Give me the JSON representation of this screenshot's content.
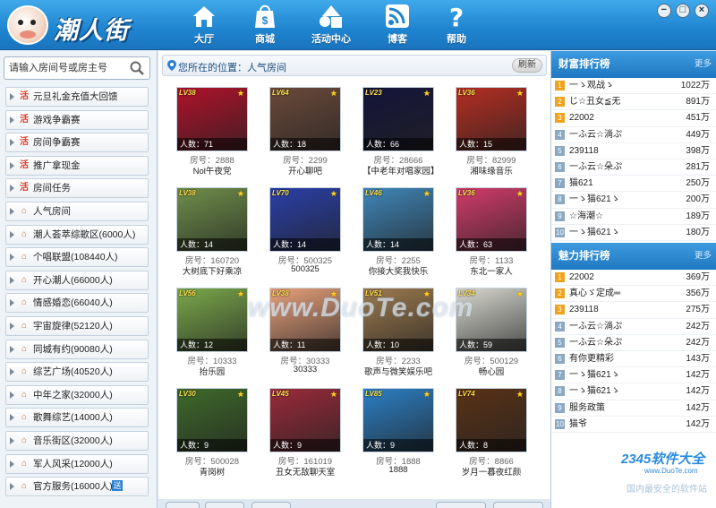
{
  "app": {
    "logo_text": "潮人街"
  },
  "nav": [
    {
      "label": "大厅",
      "icon": "home-icon"
    },
    {
      "label": "商城",
      "icon": "shopping-bag-icon"
    },
    {
      "label": "活动中心",
      "icon": "shapes-icon"
    },
    {
      "label": "博客",
      "icon": "rss-icon"
    },
    {
      "label": "帮助",
      "icon": "question-icon"
    }
  ],
  "window_buttons": [
    "−",
    "□",
    "×"
  ],
  "search": {
    "placeholder": "请输入房间号或房主号"
  },
  "menu": [
    {
      "label": "元旦礼金充值大回馈",
      "icon": "hot"
    },
    {
      "label": "游戏争霸赛",
      "icon": "hot"
    },
    {
      "label": "房间争霸赛",
      "icon": "hot"
    },
    {
      "label": "推广拿现金",
      "icon": "hot"
    },
    {
      "label": "房间任务",
      "icon": "hot"
    },
    {
      "label": "人气房间",
      "icon": "house"
    },
    {
      "label": "潮人荟萃综歌区(6000人)",
      "icon": "house"
    },
    {
      "label": "个唱联盟(108440人)",
      "icon": "house"
    },
    {
      "label": "开心潮人(66000人)",
      "icon": "house"
    },
    {
      "label": "情感婚恋(66040人)",
      "icon": "house"
    },
    {
      "label": "宇宙旋律(52120人)",
      "icon": "house"
    },
    {
      "label": "同城有约(90080人)",
      "icon": "house"
    },
    {
      "label": "综艺广场(40520人)",
      "icon": "house"
    },
    {
      "label": "中年之家(32000人)",
      "icon": "house"
    },
    {
      "label": "歌舞综艺(14000人)",
      "icon": "house"
    },
    {
      "label": "音乐街区(32000人)",
      "icon": "house"
    },
    {
      "label": "军人风采(12000人)",
      "icon": "house"
    },
    {
      "label": "官方服务(16000人)",
      "icon": "house",
      "badge": "送"
    }
  ],
  "location": {
    "text": "您所在的位置：人气房间",
    "refresh_label": "刷新"
  },
  "rooms": [
    {
      "level": "LV38",
      "count": "人数：71",
      "room_no": "房号：2888",
      "name": "Nol午夜党",
      "theme": "#b0122a"
    },
    {
      "level": "LV64",
      "count": "人数：18",
      "room_no": "房号：2299",
      "name": "开心聊吧",
      "theme": "#6b4a3a"
    },
    {
      "level": "LV23",
      "count": "人数：66",
      "room_no": "房号：28666",
      "name": "【中老年对唱家园】",
      "theme": "#14143a"
    },
    {
      "level": "LV36",
      "count": "人数：15",
      "room_no": "房号：82999",
      "name": "湘味缘音乐",
      "theme": "#b52e22"
    },
    {
      "level": "LV38",
      "count": "人数：14",
      "room_no": "房号：160720",
      "name": "大树底下好乘凉",
      "theme": "#6f8f4a"
    },
    {
      "level": "LV70",
      "count": "人数：14",
      "room_no": "房号：500325",
      "name": "500325",
      "theme": "#2a3fa8"
    },
    {
      "level": "LV46",
      "count": "人数：14",
      "room_no": "房号：2255",
      "name": "你接大奖我快乐",
      "theme": "#3f86b8"
    },
    {
      "level": "LV36",
      "count": "人数：63",
      "room_no": "房号：1133",
      "name": "东北一家人",
      "theme": "#d23b6a"
    },
    {
      "level": "LV56",
      "count": "人数：12",
      "room_no": "房号：10333",
      "name": "抬乐园",
      "theme": "#7aa84a"
    },
    {
      "level": "LV38",
      "count": "人数：11",
      "room_no": "房号：30333",
      "name": "30333",
      "theme": "#e7a07a"
    },
    {
      "level": "LV51",
      "count": "人数：10",
      "room_no": "房号：2233",
      "name": "歌声与微笑娱乐吧",
      "theme": "#9c7a4e"
    },
    {
      "level": "LV34",
      "count": "人数：59",
      "room_no": "房号：500129",
      "name": "畅心园",
      "theme": "#d8d8d0"
    },
    {
      "level": "LV30",
      "count": "人数：9",
      "room_no": "房号：500028",
      "name": "青岗树",
      "theme": "#3e6a2a"
    },
    {
      "level": "LV45",
      "count": "人数：9",
      "room_no": "房号：161019",
      "name": "丑女无敌聊天室",
      "theme": "#9a2a3a"
    },
    {
      "level": "LV85",
      "count": "人数：9",
      "room_no": "房号：1888",
      "name": "1888",
      "theme": "#2b7fc4"
    },
    {
      "level": "LV74",
      "count": "人数：8",
      "room_no": "房号：8866",
      "name": "岁月一暮夜红颜",
      "theme": "#5a3216"
    }
  ],
  "wealth_rank": {
    "title": "财富排行榜",
    "more": "更多",
    "rows": [
      {
        "name": "一ゝ观战ゝ",
        "value": "1022万"
      },
      {
        "name": "じ☆丑女≦无",
        "value": "891万"
      },
      {
        "name": "22002",
        "value": "451万"
      },
      {
        "name": "一ふ云☆淌ぷ",
        "value": "449万"
      },
      {
        "name": "239118",
        "value": "398万"
      },
      {
        "name": "一ふ云☆朵ぷ",
        "value": "281万"
      },
      {
        "name": "猫621",
        "value": "250万"
      },
      {
        "name": "一ゝ猫621ゝ",
        "value": "200万"
      },
      {
        "name": "☆海潮☆",
        "value": "189万"
      },
      {
        "name": "一ゝ猫621ゝ",
        "value": "180万"
      }
    ]
  },
  "charm_rank": {
    "title": "魅力排行榜",
    "more": "更多",
    "rows": [
      {
        "name": "22002",
        "value": "369万"
      },
      {
        "name": "真心ゞ定成═",
        "value": "356万"
      },
      {
        "name": "239118",
        "value": "275万"
      },
      {
        "name": "一ふ云☆淌ぷ",
        "value": "242万"
      },
      {
        "name": "一ふ云☆朵ぷ",
        "value": "242万"
      },
      {
        "name": "有你更精彩",
        "value": "143万"
      },
      {
        "name": "一ゝ猫621ゝ",
        "value": "142万"
      },
      {
        "name": "一ゝ猫621ゝ",
        "value": "142万"
      },
      {
        "name": "服务政策",
        "value": "142万"
      },
      {
        "name": "猫爷",
        "value": "142万"
      }
    ]
  },
  "watermark": {
    "brand": "2345软件大全",
    "url": "www.DuoTe.com",
    "slogan": "国内最安全的软件站",
    "center": "www.DuoTe.com"
  }
}
